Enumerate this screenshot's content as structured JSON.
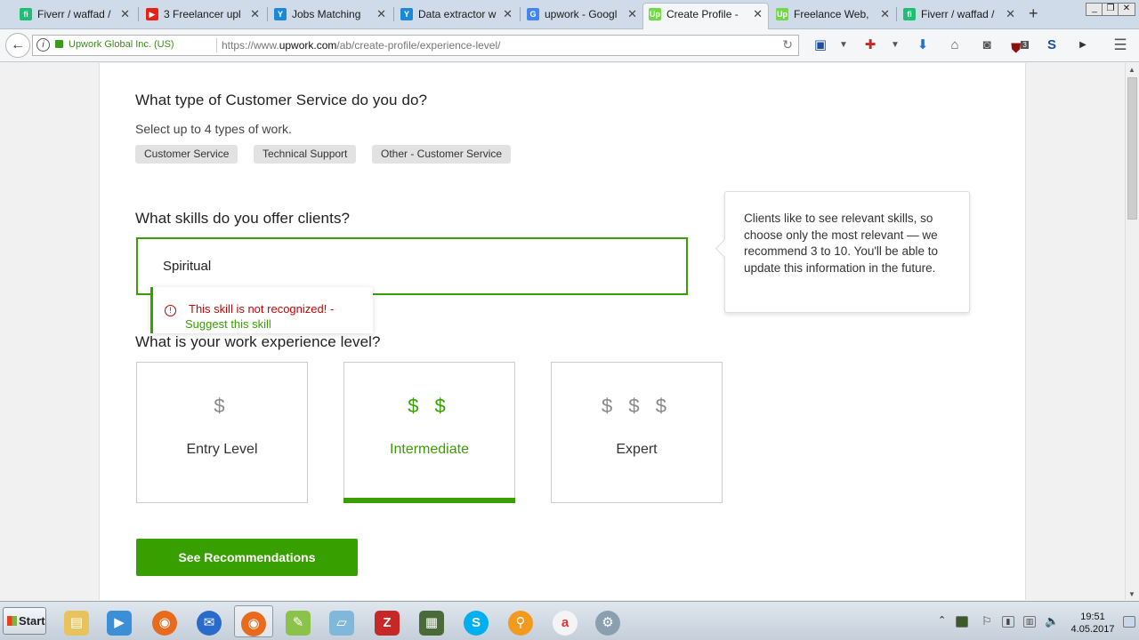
{
  "browser": {
    "tabs": [
      {
        "label": "Fiverr / waffad /",
        "favicon": "fiverr-icon",
        "fav_text": "fi",
        "color": "#1dbf73"
      },
      {
        "label": "3 Freelancer upl",
        "favicon": "youtube-icon",
        "fav_text": "▶",
        "color": "#e62117"
      },
      {
        "label": "Jobs Matching",
        "favicon": "bird-icon",
        "fav_text": "Y",
        "color": "#1b8ad6"
      },
      {
        "label": "Data extractor w",
        "favicon": "bird-icon",
        "fav_text": "Y",
        "color": "#1b8ad6"
      },
      {
        "label": "upwork - Googl",
        "favicon": "google-icon",
        "fav_text": "G",
        "color": "#4285f4"
      },
      {
        "label": "Create Profile -",
        "favicon": "upwork-icon",
        "fav_text": "Up",
        "color": "#6fda44",
        "active": true
      },
      {
        "label": "Freelance Web,",
        "favicon": "upwork-icon",
        "fav_text": "Up",
        "color": "#6fda44"
      },
      {
        "label": "Fiverr / waffad /",
        "favicon": "fiverr-icon",
        "fav_text": "fi",
        "color": "#1dbf73"
      }
    ],
    "new_tab": "+",
    "identity": "Upwork Global Inc. (US)",
    "url_prefix": "https://www.",
    "url_domain": "upwork.com",
    "url_path": "/ab/create-profile/experience-level/",
    "badge_count": "3"
  },
  "page": {
    "work_type": {
      "title": "What type of Customer Service do you do?",
      "subtitle": "Select up to 4 types of work.",
      "chips": [
        "Customer Service",
        "Technical Support",
        "Other - Customer Service"
      ]
    },
    "skills": {
      "title": "What skills do you offer clients?",
      "input_value": "Spiritual",
      "error_message": "This skill is not recognized! -",
      "suggest_link": "Suggest this skill",
      "tip": "Clients like to see relevant skills, so choose only the most relevant — we recommend 3 to 10. You'll be able to update this information in the future."
    },
    "experience": {
      "title": "What is your work experience level?",
      "levels": [
        {
          "symbol": "$",
          "name": "Entry Level"
        },
        {
          "symbol": "$ $",
          "name": "Intermediate",
          "selected": true
        },
        {
          "symbol": "$ $ $",
          "name": "Expert"
        }
      ]
    },
    "cta_label": "See Recommendations"
  },
  "taskbar": {
    "start_label": "Start",
    "time": "19:51",
    "date": "4.05.2017"
  },
  "colors": {
    "brand_green": "#37a000",
    "error_red": "#cc0000"
  }
}
